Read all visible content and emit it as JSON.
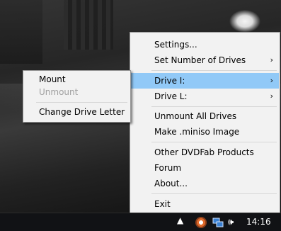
{
  "main_menu": {
    "items": [
      {
        "label": "Settings...",
        "has_submenu": false
      },
      {
        "label": "Set Number of Drives",
        "has_submenu": true
      },
      {
        "label": "Drive I:",
        "has_submenu": true,
        "highlighted": true
      },
      {
        "label": "Drive L:",
        "has_submenu": true
      },
      {
        "label": "Unmount All Drives",
        "has_submenu": false
      },
      {
        "label": "Make .miniso Image",
        "has_submenu": false
      },
      {
        "label": "Other DVDFab Products",
        "has_submenu": false
      },
      {
        "label": "Forum",
        "has_submenu": false
      },
      {
        "label": "About...",
        "has_submenu": false
      },
      {
        "label": "Exit",
        "has_submenu": false
      }
    ],
    "submenu_arrow": "›"
  },
  "sub_menu": {
    "items": [
      {
        "label": "Mount",
        "enabled": true
      },
      {
        "label": "Unmount",
        "enabled": false
      },
      {
        "label": "Change Drive Letter",
        "enabled": true
      }
    ]
  },
  "taskbar": {
    "tray_icons": [
      "show-hidden-icons-arrow",
      "dvdfab-virtual-drive-icon",
      "network-icon",
      "volume-icon"
    ],
    "show_hidden_glyph": "▲",
    "volume_glyph": "🕪",
    "clock": "14:16"
  },
  "colors": {
    "menu_bg": "#f2f2f2",
    "highlight": "#91c9f7",
    "disabled_text": "#a0a0a0",
    "taskbar_bg": "#111215"
  }
}
